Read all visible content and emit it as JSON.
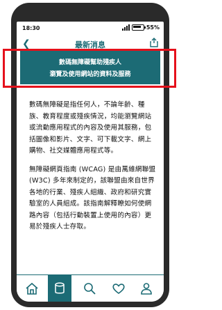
{
  "status": {
    "time": "18:30",
    "battery": "55%"
  },
  "nav": {
    "title": "最新消息"
  },
  "banner": {
    "line1": "數碼無障礙幫助殘疾人",
    "line2": "瀏覽及使用網站的資料及服務"
  },
  "content": {
    "paragraph1": "數碼無障礙是指任何人，不論年齡、種族、教育程度或殘疾情況，均能瀏覽網站或流動應用程式的內容及使用其服務，包括圖像和影片、文字、可下載文字、網上購物、社交媒體應用程式等。",
    "paragraph2": "無障礙網頁指南 (WCAG) 是由萬維網聯盟 (W3C) 多年來制定的，該聯盟由來自世界各地的行業、殘疾人組織、政府和研究實驗室的人員組成。該指南解釋瞭如何使網路內容（包括行動裝置上使用的內容）更易於殘疾人士存取。"
  },
  "tabs": [
    {
      "icon": "home-icon",
      "active": false
    },
    {
      "icon": "database-icon",
      "active": true
    },
    {
      "icon": "search-icon",
      "active": false
    },
    {
      "icon": "heart-icon",
      "active": false
    },
    {
      "icon": "user-icon",
      "active": false
    }
  ]
}
